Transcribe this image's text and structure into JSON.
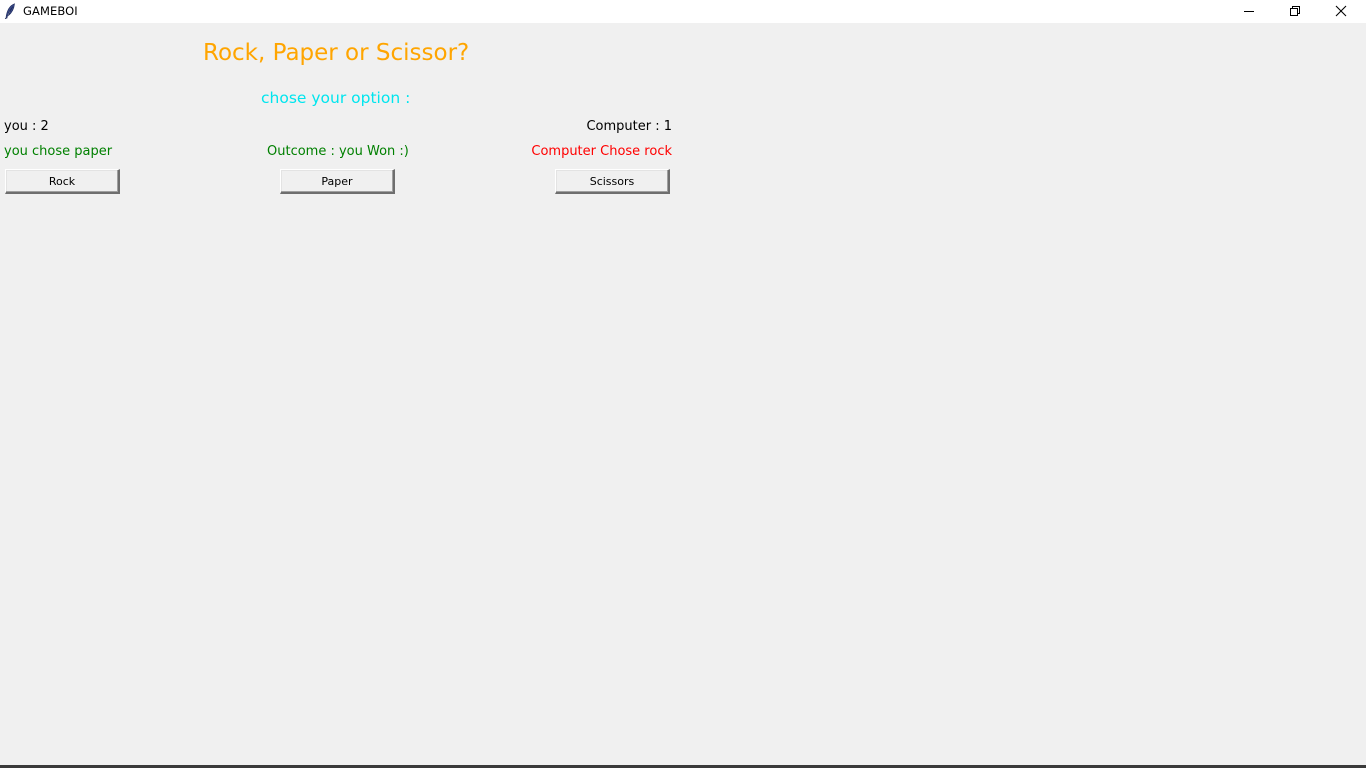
{
  "window": {
    "title": "GAMEBOI",
    "icons": {
      "app": "feather-icon",
      "minimize": "minimize-icon",
      "maximize": "restore-icon",
      "close": "close-icon"
    }
  },
  "game": {
    "heading": "Rock, Paper or Scissor?",
    "prompt": "chose your option :",
    "score_you": "you : 2",
    "score_computer": "Computer : 1",
    "you_chose": "you chose paper",
    "outcome": "Outcome : you Won :)",
    "computer_chose": "Computer Chose rock"
  },
  "buttons": {
    "rock": "Rock",
    "paper": "Paper",
    "scissors": "Scissors"
  },
  "colors": {
    "heading": "#ffa500",
    "prompt": "#00e5ee",
    "win": "#008000",
    "computer": "#ff0000",
    "background": "#f0f0f0"
  }
}
